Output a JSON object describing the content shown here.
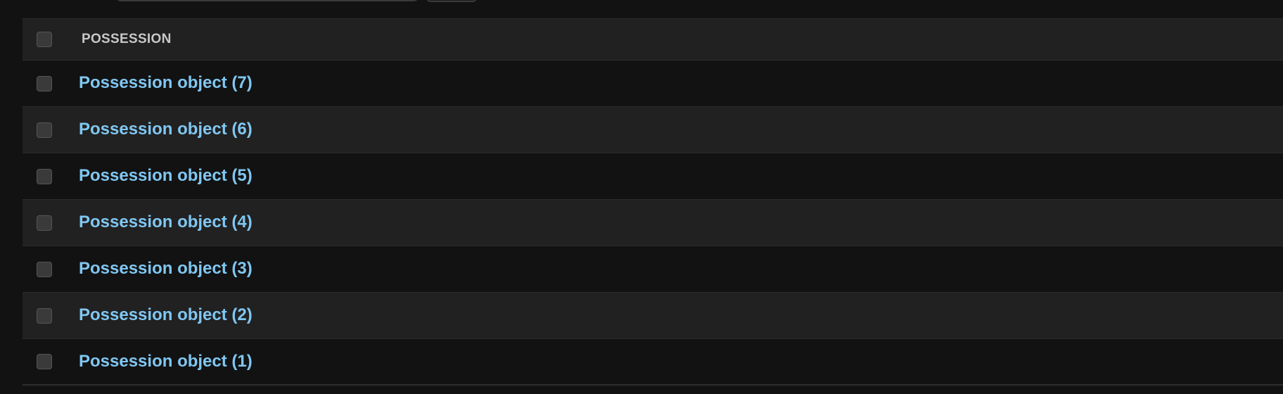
{
  "table": {
    "column_header": "POSSESSION",
    "rows": [
      {
        "label": "Possession object (7)"
      },
      {
        "label": "Possession object (6)"
      },
      {
        "label": "Possession object (5)"
      },
      {
        "label": "Possession object (4)"
      },
      {
        "label": "Possession object (3)"
      },
      {
        "label": "Possession object (2)"
      },
      {
        "label": "Possession object (1)"
      }
    ]
  },
  "colors": {
    "background": "#121212",
    "row_alt": "#212121",
    "link": "#80c7f2",
    "header_text": "#c8c8c8"
  }
}
